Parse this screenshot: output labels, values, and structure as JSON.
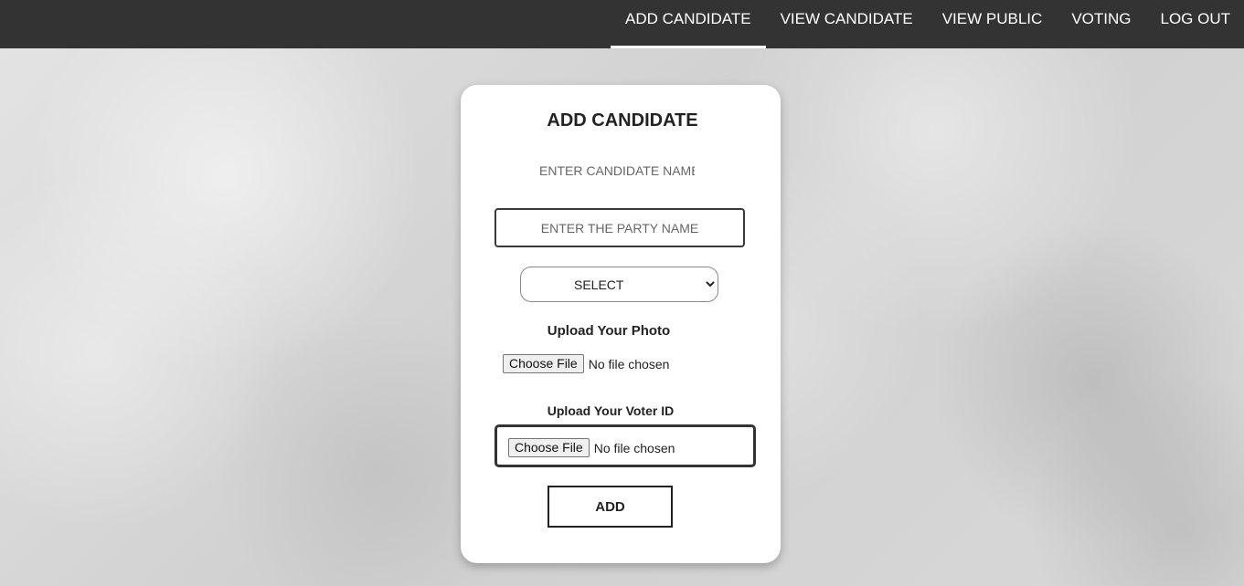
{
  "nav": {
    "items": [
      {
        "label": "ADD CANDIDATE"
      },
      {
        "label": "VIEW CANDIDATE"
      },
      {
        "label": "VIEW PUBLIC"
      },
      {
        "label": "VOTING"
      },
      {
        "label": "LOG OUT"
      }
    ],
    "active_item": "ADD CANDIDATE"
  },
  "form": {
    "title": "ADD CANDIDATE",
    "candidate_name": {
      "value": "",
      "placeholder": "ENTER CANDIDATE NAME"
    },
    "party_name": {
      "value": "",
      "placeholder": "ENTER THE PARTY NAME"
    },
    "select": {
      "selected": "SELECT"
    },
    "photo": {
      "label": "Upload Your Photo",
      "button_label": "Choose File",
      "status": "No file chosen"
    },
    "voter_id": {
      "label": "Upload Your Voter ID",
      "button_label": "Choose File",
      "status": "No file chosen"
    },
    "submit_label": "ADD"
  },
  "colors": {
    "navbar_bg": "#333333",
    "nav_text": "#ffffff",
    "card_bg": "#ffffff"
  }
}
